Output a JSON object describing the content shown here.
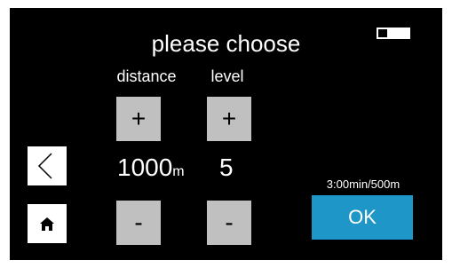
{
  "title": "please choose",
  "battery": {
    "level": 0.3
  },
  "columns": {
    "distance": {
      "label": "distance",
      "plus_label": "+",
      "minus_label": "-",
      "value": "1000",
      "unit": "m"
    },
    "level": {
      "label": "level",
      "plus_label": "+",
      "minus_label": "-",
      "value": "5"
    }
  },
  "nav": {
    "back_icon": "chevron-left-icon",
    "home_icon": "home-icon"
  },
  "pace": "3:00min/500m",
  "ok_label": "OK",
  "colors": {
    "background": "#000000",
    "button_gray": "#c0c0c0",
    "accent": "#1e96c8"
  }
}
